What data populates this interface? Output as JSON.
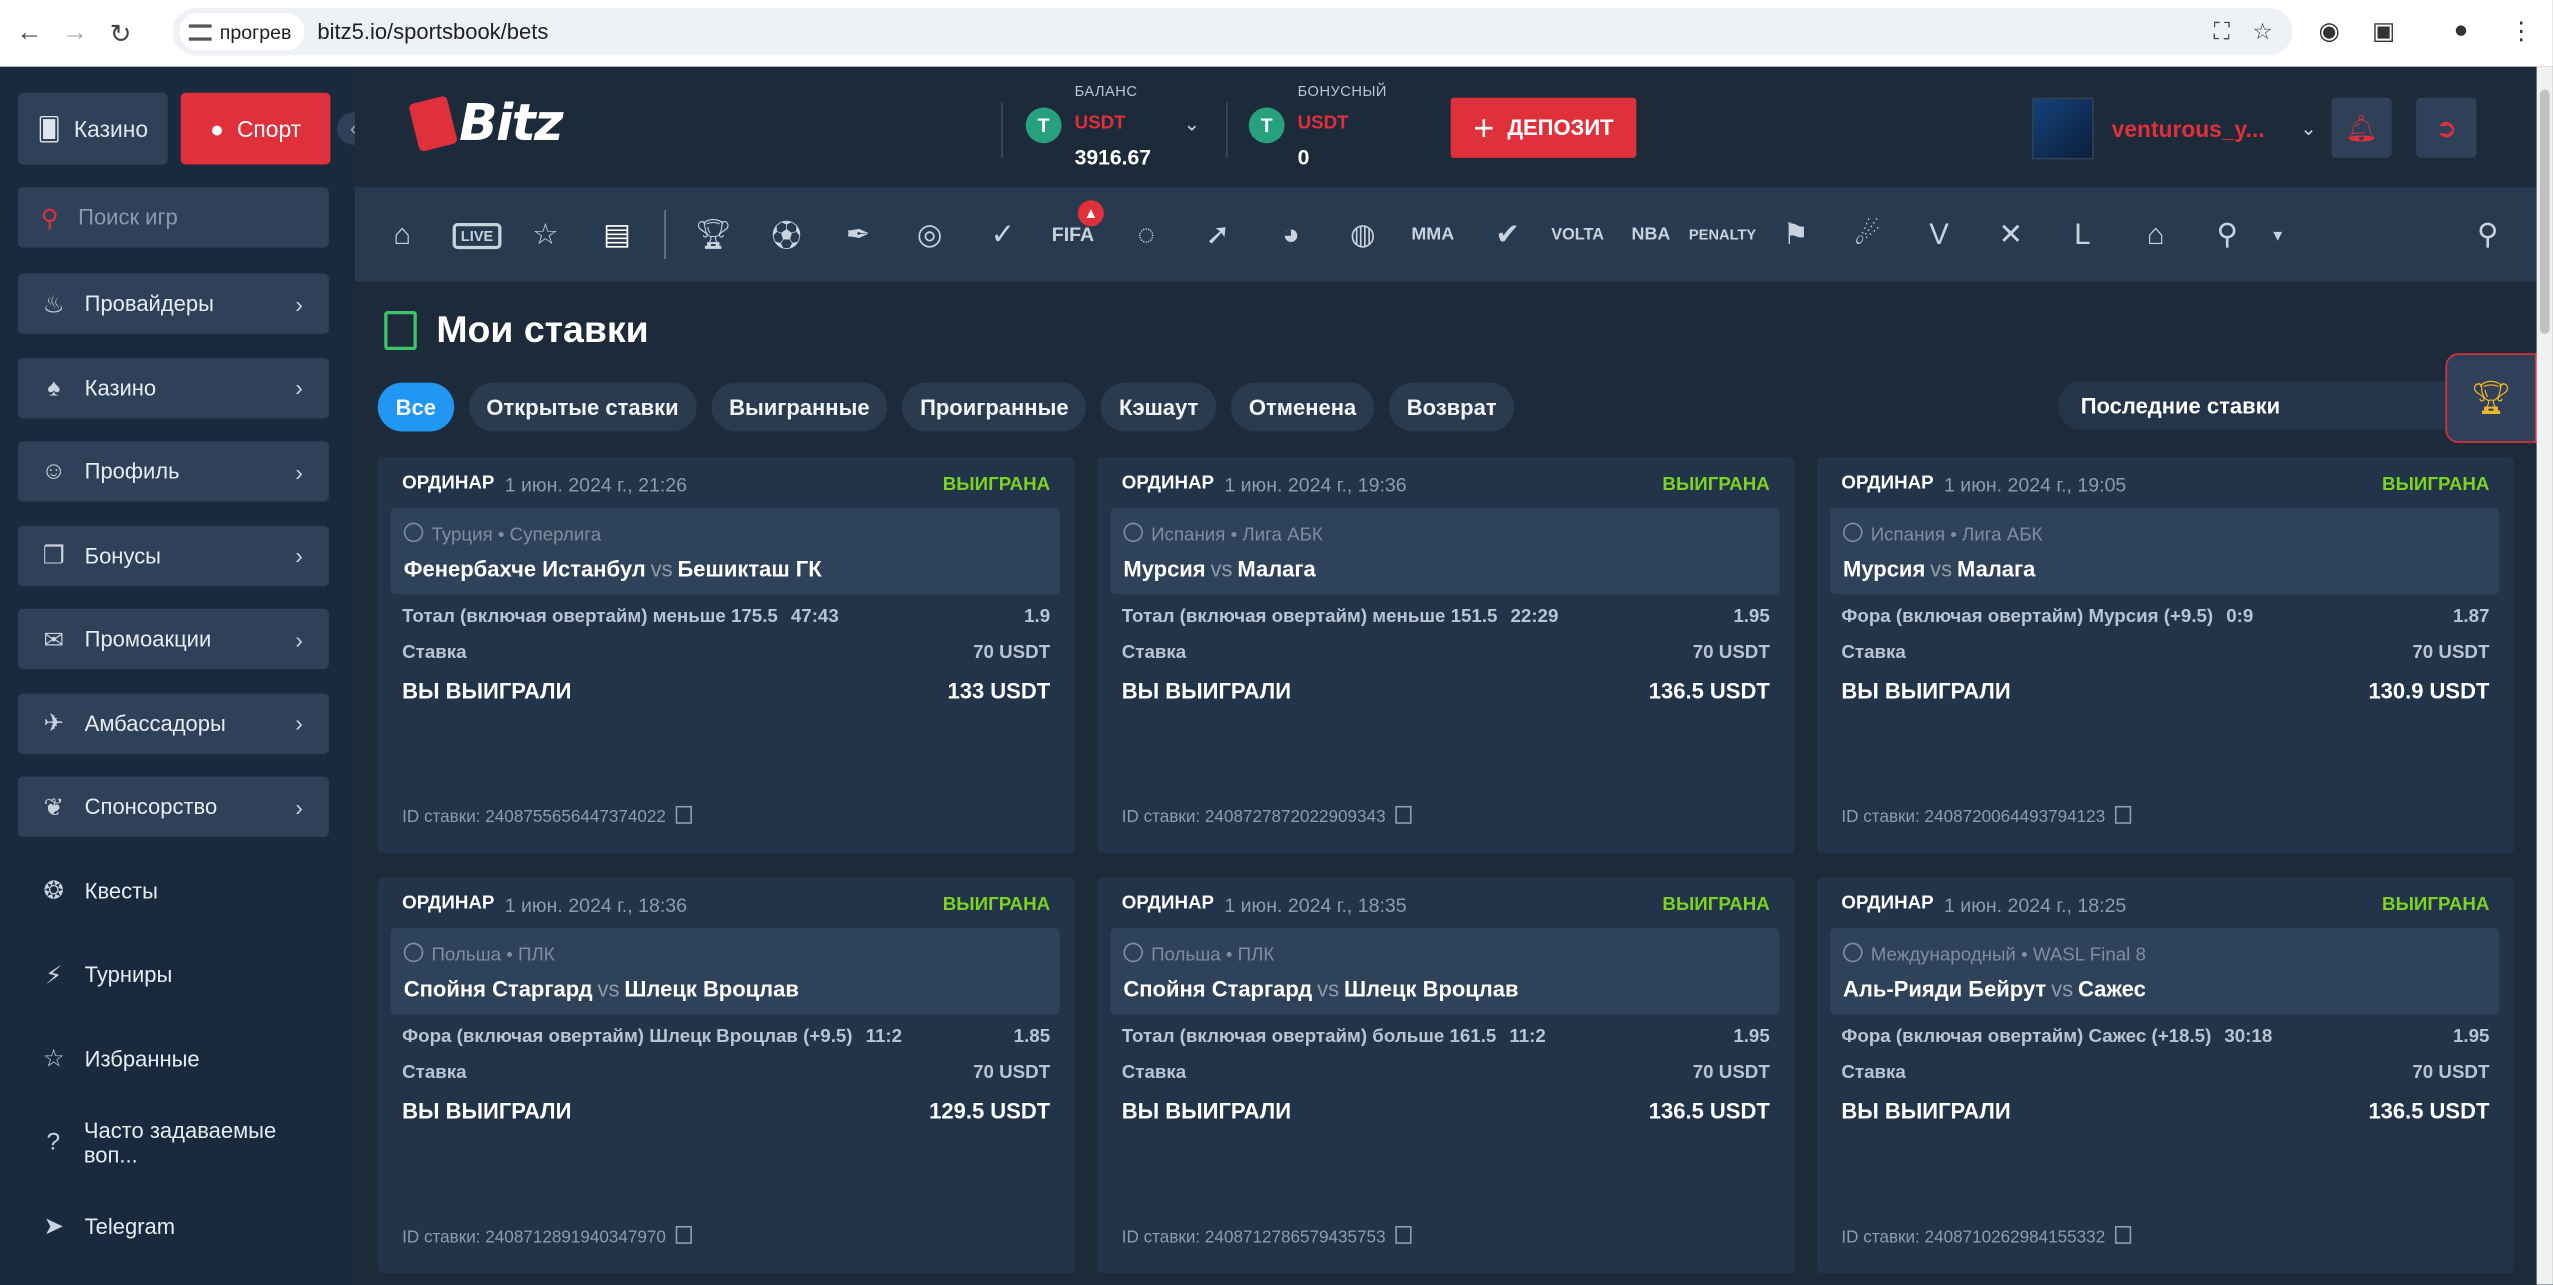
{
  "browser": {
    "site_chip": "прогрев",
    "url": "bitz5.io/sportsbook/bets"
  },
  "sidebar": {
    "casino_label": "Казино",
    "sport_label": "Спорт",
    "search_placeholder": "Поиск игр",
    "items": [
      {
        "label": "Провайдеры",
        "icon": "fire-icon",
        "boxed": true,
        "chevron": true
      },
      {
        "label": "Казино",
        "icon": "cards-icon",
        "boxed": true,
        "chevron": true
      },
      {
        "label": "Профиль",
        "icon": "user-icon",
        "boxed": true,
        "chevron": true
      },
      {
        "label": "Бонусы",
        "icon": "gift-icon",
        "boxed": true,
        "chevron": true
      },
      {
        "label": "Промоакции",
        "icon": "megaphone-icon",
        "boxed": true,
        "chevron": true
      },
      {
        "label": "Амбассадоры",
        "icon": "rocket-icon",
        "boxed": true,
        "chevron": true
      },
      {
        "label": "Спонсорство",
        "icon": "handshake-icon",
        "boxed": true,
        "chevron": true
      },
      {
        "label": "Квесты",
        "icon": "quest-icon",
        "boxed": false,
        "chevron": false
      },
      {
        "label": "Турниры",
        "icon": "bolt-icon",
        "boxed": false,
        "chevron": false
      },
      {
        "label": "Избранные",
        "icon": "star-icon",
        "boxed": false,
        "chevron": false
      },
      {
        "label": "Часто задаваемые воп...",
        "icon": "question-icon",
        "boxed": false,
        "chevron": false
      },
      {
        "label": "Telegram",
        "icon": "telegram-icon",
        "boxed": false,
        "chevron": false
      }
    ]
  },
  "header": {
    "logo_text": "Bitz",
    "balance": {
      "caption": "БАЛАНС",
      "currency": "USDT",
      "amount": "3916.67"
    },
    "bonus": {
      "caption": "БОНУСНЫЙ",
      "currency": "USDT",
      "amount": "0"
    },
    "deposit_label": "ДЕПОЗИТ",
    "username": "venturous_y..."
  },
  "page": {
    "title": "Мои ставки",
    "tabs": [
      "Все",
      "Открытые ставки",
      "Выигранные",
      "Проигранные",
      "Кэшаут",
      "Отменена",
      "Возврат"
    ],
    "active_tab": "Все",
    "filter_value": "Последние ставки"
  },
  "bets": [
    {
      "type": "ОРДИНАР",
      "date": "1 июн. 2024 г., 21:26",
      "status": "ВЫИГРАНА",
      "league": "Турция • Суперлига",
      "home": "Фенербахче Истанбул",
      "vs": "vs",
      "away": "Бешикташ ГК",
      "market": "Тотал (включая овертайм) меньше 175.5",
      "score": "47:43",
      "odds": "1.9",
      "stake_label": "Ставка",
      "stake": "70 USDT",
      "win_label": "ВЫ ВЫИГРАЛИ",
      "win": "133 USDT",
      "bet_id": "ID ставки: 2408755656447374022"
    },
    {
      "type": "ОРДИНАР",
      "date": "1 июн. 2024 г., 19:36",
      "status": "ВЫИГРАНА",
      "league": "Испания • Лига АБК",
      "home": "Мурсия",
      "vs": "vs",
      "away": "Малага",
      "market": "Тотал (включая овертайм) меньше 151.5",
      "score": "22:29",
      "odds": "1.95",
      "stake_label": "Ставка",
      "stake": "70 USDT",
      "win_label": "ВЫ ВЫИГРАЛИ",
      "win": "136.5 USDT",
      "bet_id": "ID ставки: 2408727872022909343"
    },
    {
      "type": "ОРДИНАР",
      "date": "1 июн. 2024 г., 19:05",
      "status": "ВЫИГРАНА",
      "league": "Испания • Лига АБК",
      "home": "Мурсия",
      "vs": "vs",
      "away": "Малага",
      "market": "Фора (включая овертайм) Мурсия (+9.5)",
      "score": "0:9",
      "odds": "1.87",
      "stake_label": "Ставка",
      "stake": "70 USDT",
      "win_label": "ВЫ ВЫИГРАЛИ",
      "win": "130.9 USDT",
      "bet_id": "ID ставки: 2408720064493794123"
    },
    {
      "type": "ОРДИНАР",
      "date": "1 июн. 2024 г., 18:36",
      "status": "ВЫИГРАНА",
      "league": "Польша • ПЛК",
      "home": "Спойня Старгард",
      "vs": "vs",
      "away": "Шлецк Вроцлав",
      "market": "Фора (включая овертайм) Шлецк Вроцлав (+9.5)",
      "score": "11:2",
      "odds": "1.85",
      "stake_label": "Ставка",
      "stake": "70 USDT",
      "win_label": "ВЫ ВЫИГРАЛИ",
      "win": "129.5 USDT",
      "bet_id": "ID ставки: 2408712891940347970"
    },
    {
      "type": "ОРДИНАР",
      "date": "1 июн. 2024 г., 18:35",
      "status": "ВЫИГРАНА",
      "league": "Польша • ПЛК",
      "home": "Спойня Старгард",
      "vs": "vs",
      "away": "Шлецк Вроцлав",
      "market": "Тотал (включая овертайм) больше 161.5",
      "score": "11:2",
      "odds": "1.95",
      "stake_label": "Ставка",
      "stake": "70 USDT",
      "win_label": "ВЫ ВЫИГРАЛИ",
      "win": "136.5 USDT",
      "bet_id": "ID ставки: 2408712786579435753"
    },
    {
      "type": "ОРДИНАР",
      "date": "1 июн. 2024 г., 18:25",
      "status": "ВЫИГРАНА",
      "league": "Международный • WASL Final 8",
      "home": "Аль-Рияди Бейрут",
      "vs": "vs",
      "away": "Сажес",
      "market": "Фора (включая овертайм) Сажес (+18.5)",
      "score": "30:18",
      "odds": "1.95",
      "stake_label": "Ставка",
      "stake": "70 USDT",
      "win_label": "ВЫ ВЫИГРАЛИ",
      "win": "136.5 USDT",
      "bet_id": "ID ставки: 2408710262984155332"
    }
  ],
  "colors": {
    "accent_red": "#e0303b",
    "win_green": "#7ed321",
    "active_tab_blue": "#2196f3"
  }
}
